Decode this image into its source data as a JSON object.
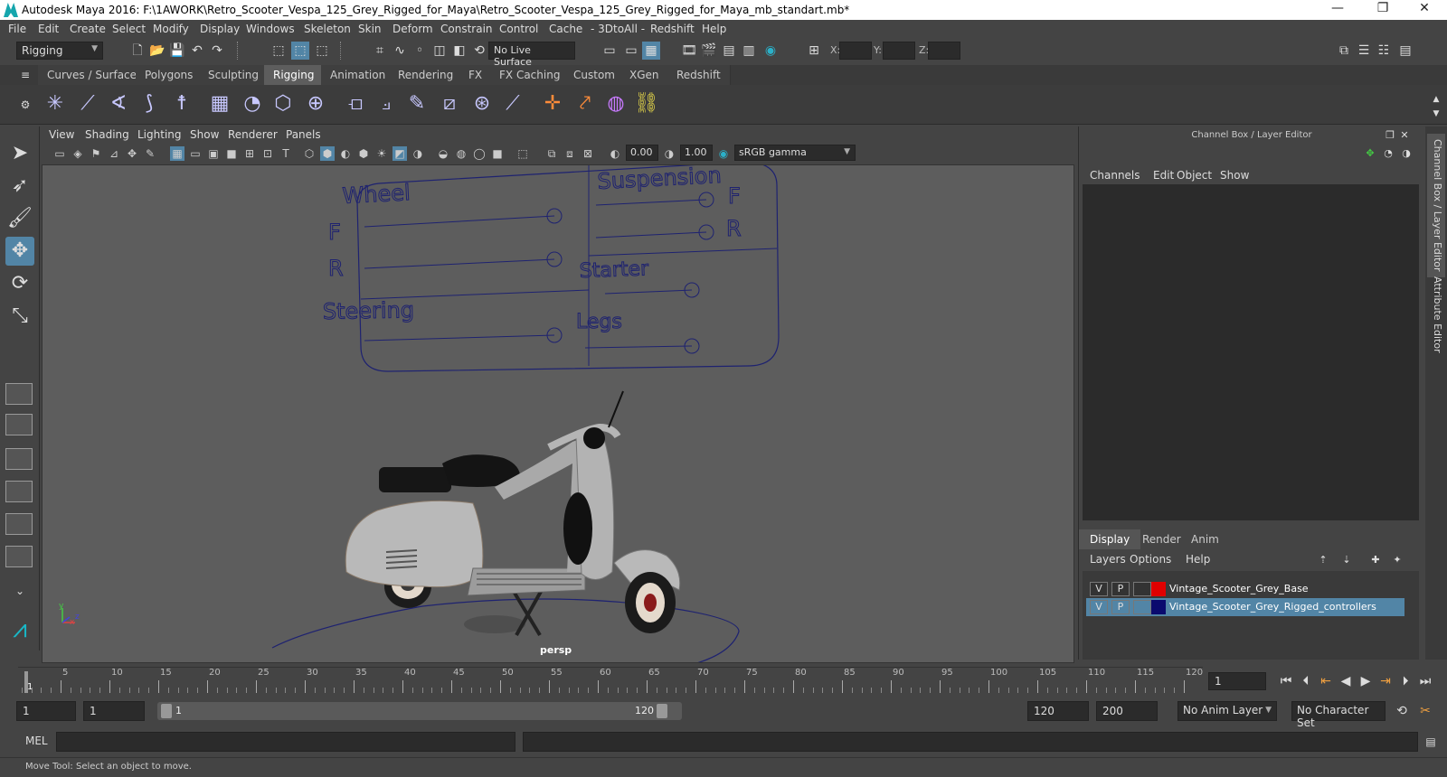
{
  "window": {
    "title": "Autodesk Maya 2016: F:\\1AWORK\\Retro_Scooter_Vespa_125_Grey_Rigged_for_Maya\\Retro_Scooter_Vespa_125_Grey_Rigged_for_Maya_mb_standart.mb*",
    "minimize": "—",
    "restore": "❐",
    "close": "✕"
  },
  "menubar": [
    "File",
    "Edit",
    "Create",
    "Select",
    "Modify",
    "Display",
    "Windows",
    "Skeleton",
    "Skin",
    "Deform",
    "Constrain",
    "Control",
    "Cache",
    "- 3DtoAll -",
    "Redshift",
    "Help"
  ],
  "statusline": {
    "menuset": "Rigging",
    "live_surface": "No Live Surface",
    "x_label": "X:",
    "y_label": "Y:",
    "z_label": "Z:"
  },
  "shelf_tabs": [
    "Curves / Surfaces",
    "Polygons",
    "Sculpting",
    "Rigging",
    "Animation",
    "Rendering",
    "FX",
    "FX Caching",
    "Custom",
    "XGen",
    "Redshift"
  ],
  "shelf_active": "Rigging",
  "panel_menu": [
    "View",
    "Shading",
    "Lighting",
    "Show",
    "Renderer",
    "Panels"
  ],
  "panel_tools": {
    "exposure": "0.00",
    "gamma": "1.00",
    "color_space": "sRGB gamma"
  },
  "viewport": {
    "camera_label": "persp",
    "rig_labels": {
      "wheel": "Wheel",
      "wheel_f": "F",
      "wheel_r": "R",
      "steering": "Steering",
      "suspension": "Suspension",
      "susp_f": "F",
      "susp_r": "R",
      "starter": "Starter",
      "legs": "Legs"
    },
    "axis": {
      "x": "x",
      "y": "y",
      "z": "z"
    },
    "colors": {
      "background": "#5d5d5d",
      "rig": "#1e2270",
      "scooter": "#b9b9b9"
    }
  },
  "channel_box": {
    "header": "Channel Box / Layer Editor",
    "menu": [
      "Channels",
      "Edit",
      "Object",
      "Show"
    ],
    "layer_tabs": [
      "Display",
      "Render",
      "Anim"
    ],
    "layer_tab_active": "Display",
    "layer_menu": [
      "Layers",
      "Options",
      "Help"
    ],
    "layers": [
      {
        "v": "V",
        "p": "P",
        "color": "#e00000",
        "name": "Vintage_Scooter_Grey_Base",
        "selected": false
      },
      {
        "v": "V",
        "p": "P",
        "color": "#0a0a6e",
        "name": "Vintage_Scooter_Grey_Rigged_controllers",
        "selected": true
      }
    ]
  },
  "side_tabs": [
    "Channel Box / Layer Editor",
    "Attribute Editor"
  ],
  "timeline": {
    "ticks": [
      "5",
      "10",
      "15",
      "20",
      "25",
      "30",
      "35",
      "40",
      "45",
      "50",
      "55",
      "60",
      "65",
      "70",
      "75",
      "80",
      "85",
      "90",
      "95",
      "100",
      "105",
      "110",
      "115",
      "120"
    ],
    "current_frame_label": "1",
    "current_frame": "1"
  },
  "range": {
    "start": "1",
    "playback_start": "1",
    "slider_start": "1",
    "slider_end": "120",
    "playback_end": "120",
    "end": "200",
    "anim_layer": "No Anim Layer",
    "character_set": "No Character Set"
  },
  "command": {
    "label": "MEL"
  },
  "help_line": "Move Tool: Select an object to move."
}
